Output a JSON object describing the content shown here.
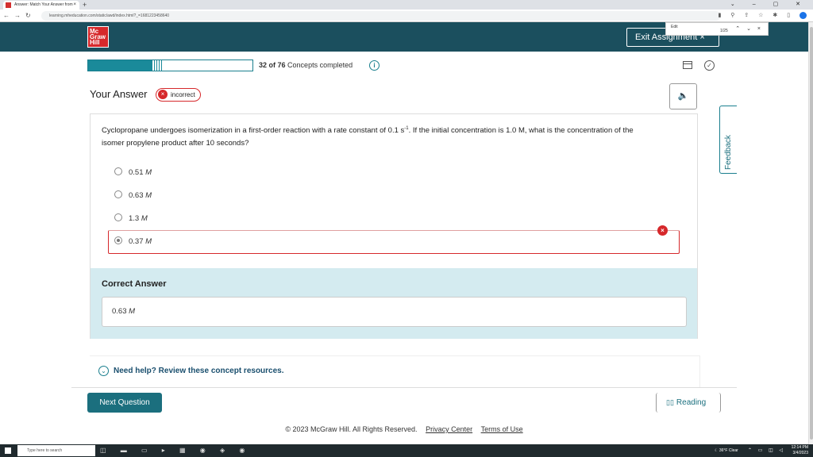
{
  "browser": {
    "tab_title": "Answer: Match Your Answer from",
    "tab_close": "×",
    "new_tab": "+",
    "nav_back": "←",
    "nav_forward": "→",
    "nav_reload": "↻",
    "url": "learning.mheducation.com/static/awd/index.html?_=1681223458640",
    "window_controls": "⌄ – ▢ ✕",
    "ext_icons": "▮ ⚲ ⇪ ☆ ✱ ▯"
  },
  "header": {
    "logo_lines": [
      "Mc",
      "Graw",
      "Hill"
    ],
    "exit_label": "Exit Assignment",
    "exit_icon": "×",
    "popup_key": "Edit",
    "popup_value": "1/25",
    "popup_controls": "⌃ ⌄ ×"
  },
  "progress": {
    "fraction": 0.386,
    "completed": "32 of 76",
    "label": "Concepts completed",
    "info_icon": "i",
    "check_icon": "✓"
  },
  "answer": {
    "title": "Your Answer",
    "status": "incorrect",
    "status_icon": "×",
    "audio_icon": "🔈"
  },
  "feedback_tab": {
    "label": "Feedback"
  },
  "question": {
    "text_before": "Cyclopropane undergoes isomerization in a first-order reaction with a rate constant of 0.1 s",
    "superscript": "-1",
    "text_after": ". If the initial concentration is 1.0 M, what is the concentration of the isomer propylene product after 10 seconds?",
    "options": [
      {
        "value": "0.51",
        "unit": "M"
      },
      {
        "value": "0.63",
        "unit": "M"
      },
      {
        "value": "1.3",
        "unit": "M"
      },
      {
        "value": "0.37",
        "unit": "M"
      }
    ],
    "selected_mark": "×"
  },
  "correct_answer": {
    "title": "Correct Answer",
    "value": "0.63",
    "unit": "M"
  },
  "help": {
    "icon": "⌄",
    "text": "Need help? Review these concept resources."
  },
  "bottom": {
    "next_label": "Next Question",
    "reading_icon": "▯▯",
    "reading_label": "Reading"
  },
  "footer": {
    "copyright": "© 2023 McGraw Hill. All Rights Reserved.",
    "privacy": "Privacy Center",
    "terms": "Terms of Use"
  },
  "taskbar": {
    "search_placeholder": "Type here to search",
    "apps": "◫ ▬ ▭ ▸ ▦ ◉ ◈ ◉",
    "weather": "☾ 36°F Clear",
    "sys_icons": "⌃ ▭ ◫ ◁",
    "time": "12:14 PM",
    "date": "3/4/2023"
  }
}
